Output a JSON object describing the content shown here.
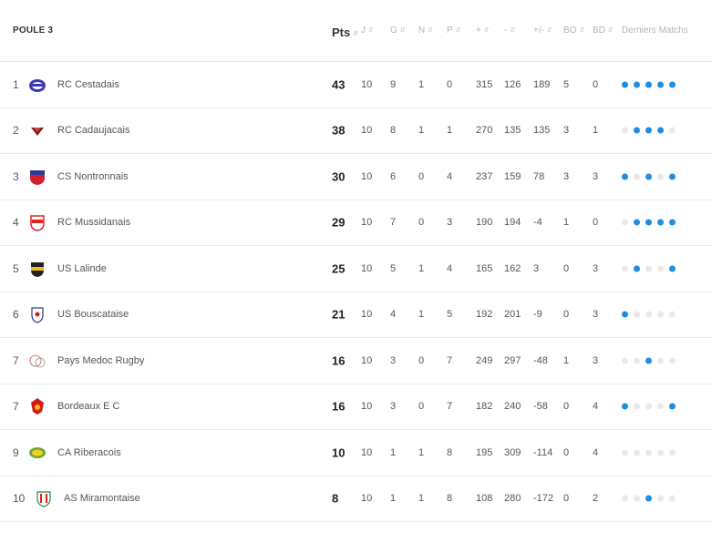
{
  "header": {
    "poule": "POULE 3",
    "columns": [
      "Pts",
      "J",
      "G",
      "N",
      "P",
      "+",
      "-",
      "+/-",
      "BO",
      "BD",
      "Derniers Matchs"
    ]
  },
  "colors": {
    "win": "#1f8ee0",
    "other": "#e8e8e8"
  },
  "rows": [
    {
      "rank": "1",
      "team": "RC Cestadais",
      "pts": "43",
      "j": "10",
      "g": "9",
      "n": "1",
      "p": "0",
      "plus": "315",
      "minus": "126",
      "diff": "189",
      "bo": "5",
      "bd": "0",
      "form": [
        "W",
        "W",
        "W",
        "W",
        "W"
      ]
    },
    {
      "rank": "2",
      "team": "RC Cadaujacais",
      "pts": "38",
      "j": "10",
      "g": "8",
      "n": "1",
      "p": "1",
      "plus": "270",
      "minus": "135",
      "diff": "135",
      "bo": "3",
      "bd": "1",
      "form": [
        "O",
        "W",
        "W",
        "W",
        "O"
      ]
    },
    {
      "rank": "3",
      "team": "CS Nontronnais",
      "pts": "30",
      "j": "10",
      "g": "6",
      "n": "0",
      "p": "4",
      "plus": "237",
      "minus": "159",
      "diff": "78",
      "bo": "3",
      "bd": "3",
      "form": [
        "W",
        "O",
        "W",
        "O",
        "W"
      ]
    },
    {
      "rank": "4",
      "team": "RC Mussidanais",
      "pts": "29",
      "j": "10",
      "g": "7",
      "n": "0",
      "p": "3",
      "plus": "190",
      "minus": "194",
      "diff": "-4",
      "bo": "1",
      "bd": "0",
      "form": [
        "O",
        "W",
        "W",
        "W",
        "W"
      ]
    },
    {
      "rank": "5",
      "team": "US Lalinde",
      "pts": "25",
      "j": "10",
      "g": "5",
      "n": "1",
      "p": "4",
      "plus": "165",
      "minus": "162",
      "diff": "3",
      "bo": "0",
      "bd": "3",
      "form": [
        "O",
        "W",
        "O",
        "O",
        "W"
      ]
    },
    {
      "rank": "6",
      "team": "US Bouscataise",
      "pts": "21",
      "j": "10",
      "g": "4",
      "n": "1",
      "p": "5",
      "plus": "192",
      "minus": "201",
      "diff": "-9",
      "bo": "0",
      "bd": "3",
      "form": [
        "W",
        "O",
        "O",
        "O",
        "O"
      ]
    },
    {
      "rank": "7",
      "team": "Pays Medoc Rugby",
      "pts": "16",
      "j": "10",
      "g": "3",
      "n": "0",
      "p": "7",
      "plus": "249",
      "minus": "297",
      "diff": "-48",
      "bo": "1",
      "bd": "3",
      "form": [
        "O",
        "O",
        "W",
        "O",
        "O"
      ]
    },
    {
      "rank": "7",
      "team": "Bordeaux E C",
      "pts": "16",
      "j": "10",
      "g": "3",
      "n": "0",
      "p": "7",
      "plus": "182",
      "minus": "240",
      "diff": "-58",
      "bo": "0",
      "bd": "4",
      "form": [
        "W",
        "O",
        "O",
        "O",
        "W"
      ]
    },
    {
      "rank": "9",
      "team": "CA Riberacois",
      "pts": "10",
      "j": "10",
      "g": "1",
      "n": "1",
      "p": "8",
      "plus": "195",
      "minus": "309",
      "diff": "-114",
      "bo": "0",
      "bd": "4",
      "form": [
        "O",
        "O",
        "O",
        "O",
        "O"
      ]
    },
    {
      "rank": "10",
      "team": "AS Miramontaise",
      "pts": "8",
      "j": "10",
      "g": "1",
      "n": "1",
      "p": "8",
      "plus": "108",
      "minus": "280",
      "diff": "-172",
      "bo": "0",
      "bd": "2",
      "form": [
        "O",
        "O",
        "W",
        "O",
        "O"
      ]
    }
  ],
  "logos": [
    "cestadais-crest-icon",
    "cadaujacais-crest-icon",
    "nontronnais-crest-icon",
    "mussidanais-crest-icon",
    "lalinde-crest-icon",
    "bouscataise-crest-icon",
    "medoc-crest-icon",
    "bordeaux-crest-icon",
    "riberacois-crest-icon",
    "miramontaise-crest-icon"
  ]
}
